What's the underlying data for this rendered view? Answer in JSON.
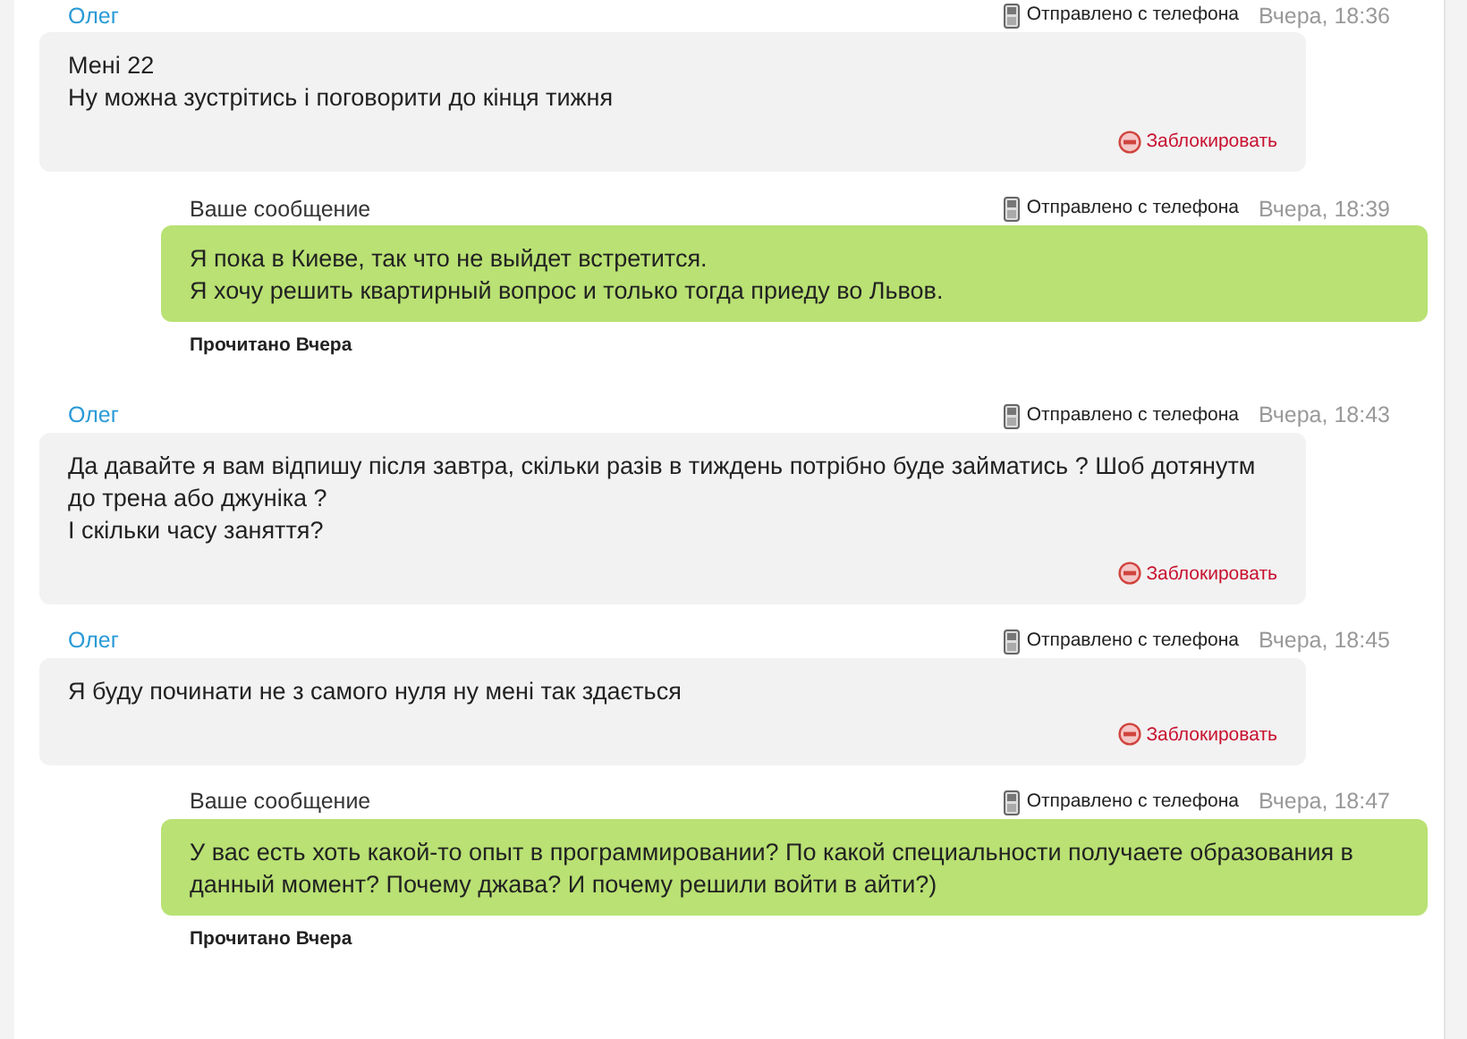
{
  "messages": [
    {
      "kind": "incoming",
      "sender": "Олег",
      "via": "Отправлено с телефона",
      "time": "Вчера, 18:36",
      "text": "Мені 22\nНу можна зустрітись і поговорити до кінця тижня",
      "action": "Заблокировать"
    },
    {
      "kind": "outgoing",
      "sender": "Ваше сообщение",
      "via": "Отправлено с телефона",
      "time": "Вчера, 18:39",
      "text": "Я пока в Киеве, так что не выйдет встретится.\nЯ хочу решить квартирный вопрос и только тогда приеду во Львов.",
      "read": "Прочитано Вчера"
    },
    {
      "kind": "incoming",
      "sender": "Олег",
      "via": "Отправлено с телефона",
      "time": "Вчера, 18:43",
      "text": "Да давайте я вам відпишу після завтра, скільки разів в тиждень потрібно буде займатись ? Шоб дотянутм до трена або джуніка ?\nІ скільки часу заняття?",
      "action": "Заблокировать"
    },
    {
      "kind": "incoming",
      "sender": "Олег",
      "via": "Отправлено с телефона",
      "time": "Вчера, 18:45",
      "text": "Я буду починати не з самого нуля ну мені так здається",
      "action": "Заблокировать"
    },
    {
      "kind": "outgoing",
      "sender": "Ваше сообщение",
      "via": "Отправлено с телефона",
      "time": "Вчера, 18:47",
      "text": "У вас есть хоть какой-то опыт в программировании? По какой специальности получаете образования в данный момент? Почему джава? И почему решили войти в айти?)",
      "read": "Прочитано Вчера"
    }
  ]
}
